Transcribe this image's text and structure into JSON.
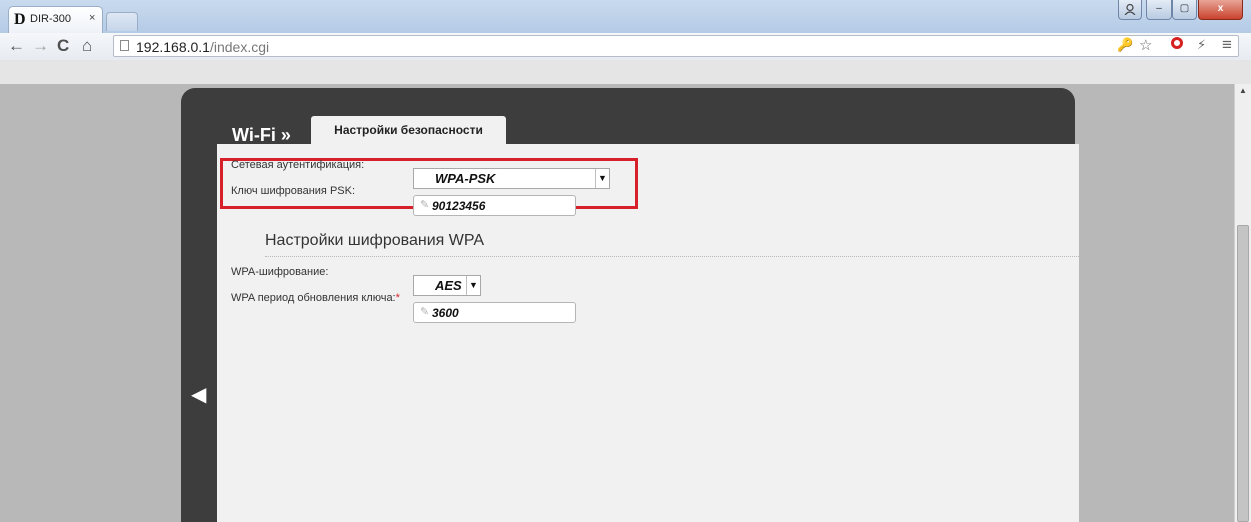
{
  "browser": {
    "tab": {
      "favicon": "D",
      "title": "DIR-300",
      "close": "×"
    },
    "window_controls": {
      "minimize": "–",
      "maximize": "▢",
      "close": "x"
    },
    "nav": {
      "back": "←",
      "forward": "→",
      "reload": "C",
      "home": "⌂"
    },
    "address": {
      "host": "192.168.0.1",
      "path": "/index.cgi"
    },
    "toolbar_icons": {
      "key": "🔑",
      "star": "☆",
      "lightning": "⚡",
      "menu": "≡"
    }
  },
  "page": {
    "breadcrumb": "Wi-Fi »",
    "active_tab": "Настройки безопасности",
    "collapse_arrow": "◀",
    "auth": {
      "label": "Сетевая аутентификация:",
      "value": "WPA-PSK"
    },
    "psk": {
      "label": "Ключ шифрования PSK:",
      "value": "90123456"
    },
    "wpa_section_title": "Настройки шифрования WPA",
    "wpa_encryption": {
      "label": "WPA-шифрование:",
      "value": "AES"
    },
    "wpa_rekey": {
      "label": "WPA период обновления ключа:",
      "required_mark": "*",
      "value": "3600"
    },
    "highlight_color": "#d6202a"
  },
  "icons": {
    "pencil": "✎",
    "dropdown": "▼",
    "scroll_up": "▲"
  }
}
